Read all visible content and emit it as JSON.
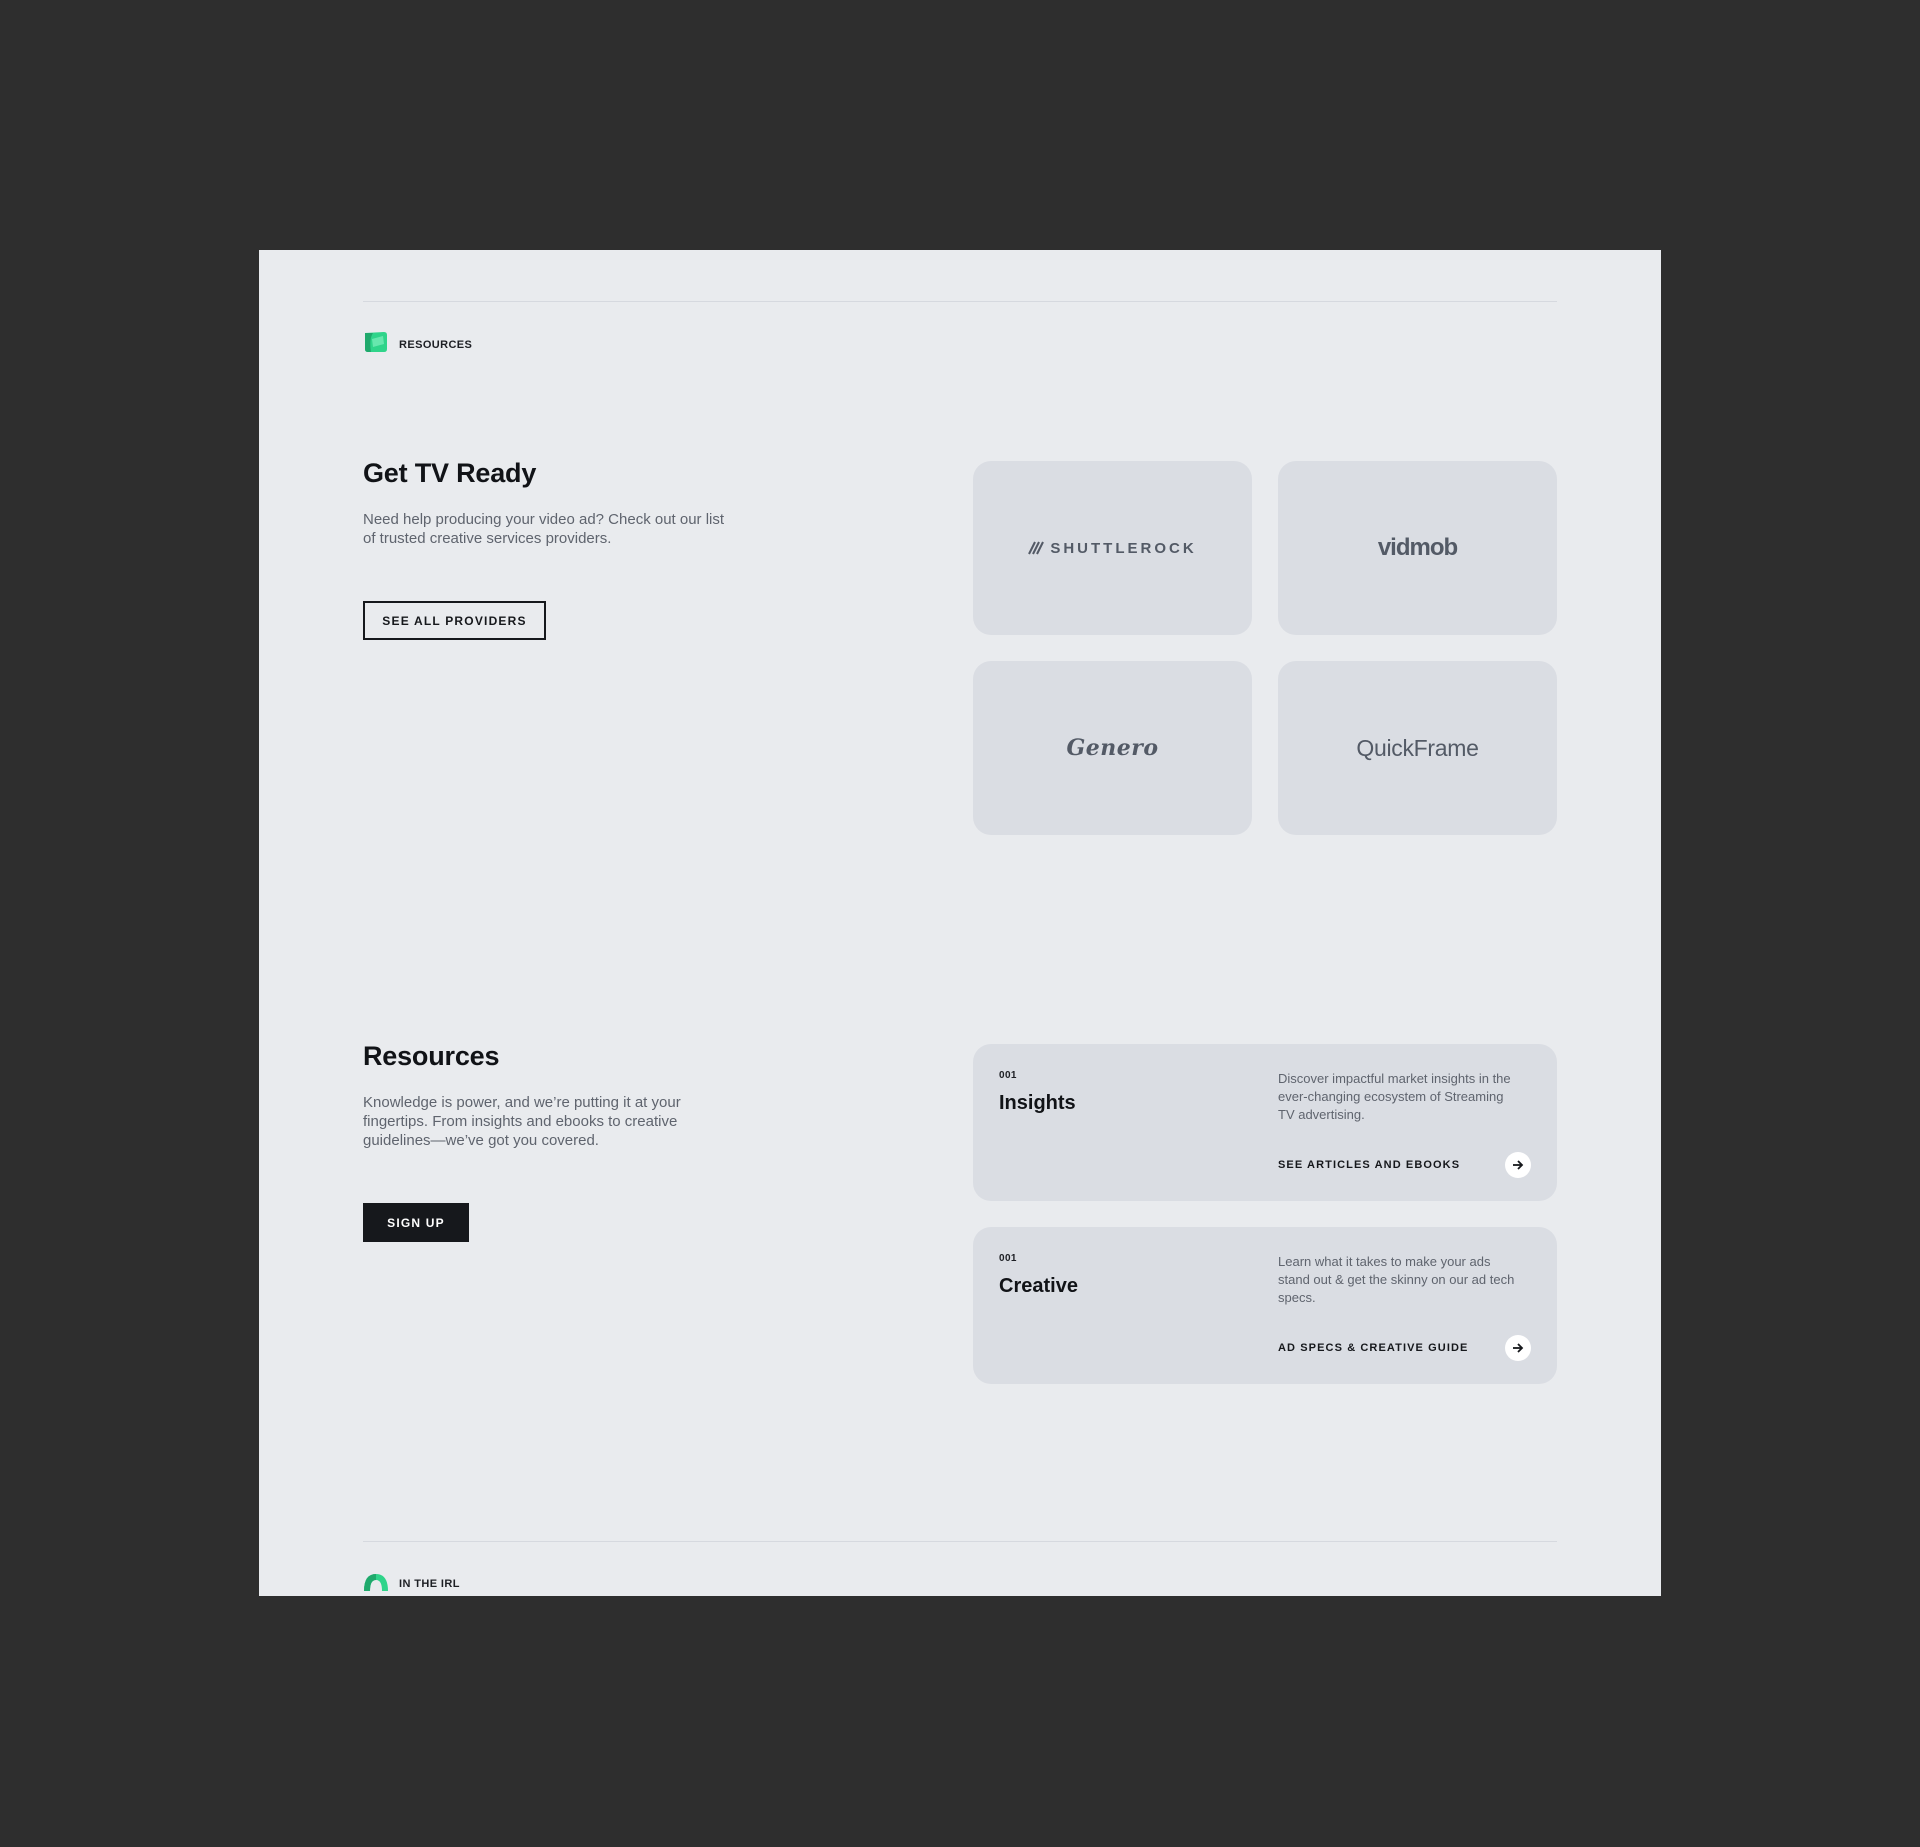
{
  "resources_tag": {
    "label": "RESOURCES",
    "icon": "green-card-icon"
  },
  "tv_ready": {
    "heading": "Get TV Ready",
    "description_line1": "Need help producing your video ad? Check out our list",
    "description_line2": "of trusted creative services providers.",
    "button_label": "SEE ALL PROVIDERS"
  },
  "providers": [
    {
      "name": "SHUTTLEROCK"
    },
    {
      "name": "vidmob"
    },
    {
      "name": "Genero"
    },
    {
      "name": "QuickFrame"
    }
  ],
  "resources": {
    "heading": "Resources",
    "description_line1": "Knowledge is power, and we’re putting it at your",
    "description_line2": "fingertips. From insights and ebooks to creative",
    "description_line3": "guidelines—we’ve got you covered.",
    "button_label": "SIGN UP",
    "cards": [
      {
        "number": "001",
        "title": "Insights",
        "description_line1": "Discover impactful market insights in the",
        "description_line2": "ever-changing ecosystem of Streaming",
        "description_line3": "TV advertising.",
        "link_label": "SEE ARTICLES AND EBOOKS"
      },
      {
        "number": "001",
        "title": "Creative",
        "description_line1": "Learn what it takes to make your ads",
        "description_line2": "stand out & get the skinny on our ad tech",
        "description_line3": "specs.",
        "link_label": "AD SPECS & CREATIVE GUIDE"
      }
    ]
  },
  "irl_tag": {
    "label": "IN THE IRL",
    "icon": "green-arch-icon"
  },
  "colors": {
    "background": "#2e2e2e",
    "page": "#e9ebee",
    "card": "#dadde3",
    "accent_green": "#2fd48a",
    "ink": "#16181c"
  }
}
